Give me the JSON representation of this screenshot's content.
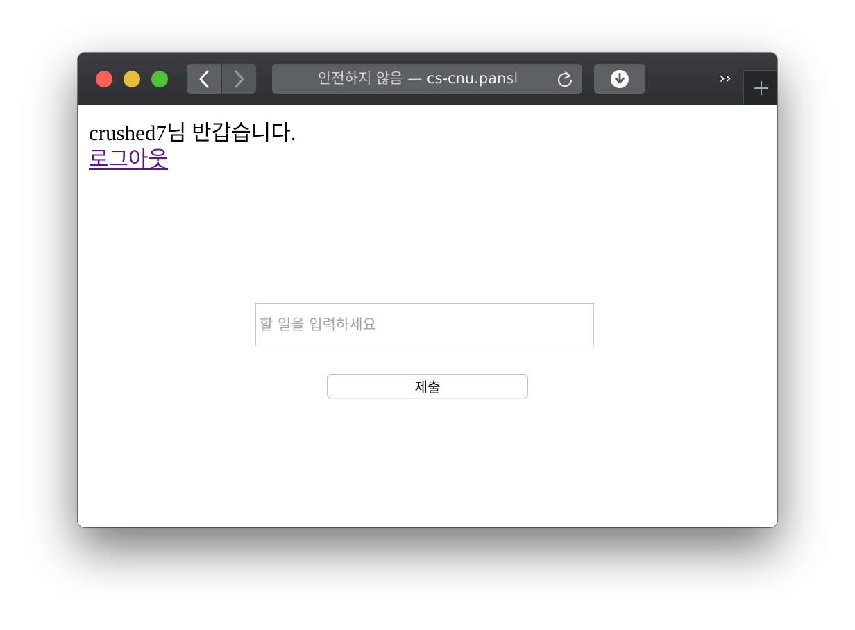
{
  "browser": {
    "address_prefix": "안전하지 않음 —",
    "address_host": "cs-cnu.pansl",
    "overflow_label": "››",
    "colors": {
      "close": "#fe5f57",
      "minimize": "#febc2e",
      "zoom": "#28c840"
    }
  },
  "page": {
    "greeting": "crushed7님 반갑습니다.",
    "logout_label": "로그아웃",
    "todo_placeholder": "할 일을 입력하세요",
    "todo_value": "",
    "submit_label": "제출"
  }
}
